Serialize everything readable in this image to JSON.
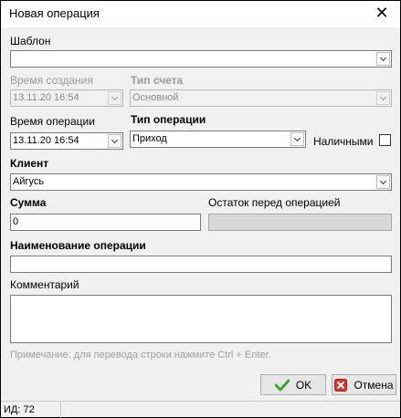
{
  "window": {
    "title": "Новая операция",
    "close_glyph": "✕"
  },
  "template": {
    "label": "Шаблон",
    "value": ""
  },
  "created_time": {
    "label": "Время создания",
    "value": "13.11.20 16:54"
  },
  "account_type": {
    "label": "Тип счета",
    "value": "Основной"
  },
  "operation_time": {
    "label": "Время операции",
    "value": "13.11.20 16:54"
  },
  "operation_type": {
    "label": "Тип операции",
    "value": "Приход"
  },
  "cash": {
    "label": "Наличными",
    "checked": false
  },
  "client": {
    "label": "Клиент",
    "value": "Айгусь"
  },
  "amount": {
    "label": "Сумма",
    "value": "0"
  },
  "balance_before": {
    "label": "Остаток перед операцией",
    "value": ""
  },
  "operation_name": {
    "label": "Наименование операции",
    "value": ""
  },
  "comment": {
    "label": "Комментарий",
    "value": ""
  },
  "note": "Примечание: для перевода строки нажмите Ctrl + Enter.",
  "buttons": {
    "ok": {
      "label": "OK",
      "icon": "check-icon",
      "color": "#3aa832"
    },
    "cancel": {
      "label": "Отмена",
      "icon": "red-x-icon",
      "color": "#d9342b"
    }
  },
  "status": {
    "id_text": "ИД: 72"
  }
}
